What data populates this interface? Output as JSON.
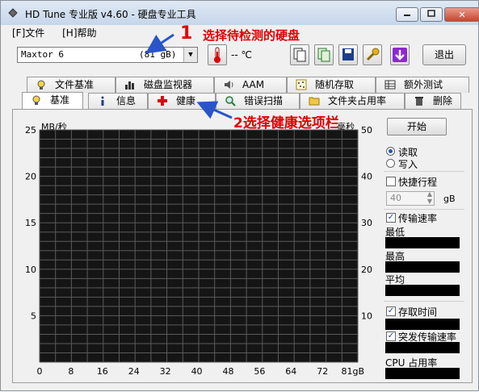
{
  "window": {
    "title": "HD Tune 专业版 v4.60 - 硬盘专业工具"
  },
  "menu": {
    "file": "[F]文件",
    "help": "[H]帮助"
  },
  "toolbar": {
    "drive": "Maxtor 6",
    "drive_capacity": "(81 gB)",
    "temperature": "-- ℃",
    "exit_label": "退出"
  },
  "tabs_top": [
    "文件基准",
    "磁盘监视器",
    "AAM",
    "随机存取",
    "额外测试"
  ],
  "tabs_bottom": [
    "基准",
    "信息",
    "健康",
    "错误扫描",
    "文件夹占用率",
    "删除"
  ],
  "chart": {
    "left_unit": "MB/秒",
    "right_unit": "毫秒",
    "left_ticks": [
      "25",
      "20",
      "15",
      "10",
      "5"
    ],
    "right_ticks": [
      "50",
      "40",
      "30",
      "20",
      "10"
    ],
    "x_ticks": [
      "0",
      "8",
      "16",
      "24",
      "32",
      "40",
      "48",
      "56",
      "64",
      "72",
      "81gB"
    ]
  },
  "chart_data": {
    "type": "line",
    "title": "",
    "xlabel": "",
    "ylabel": "MB/秒",
    "y2label": "毫秒",
    "xlim": [
      0,
      81
    ],
    "ylim": [
      0,
      25
    ],
    "y2lim": [
      0,
      50
    ],
    "x_tick_labels": [
      "0",
      "8",
      "16",
      "24",
      "32",
      "40",
      "48",
      "56",
      "64",
      "72",
      "81gB"
    ],
    "series": [],
    "grid": true
  },
  "side": {
    "start": "开始",
    "read": "读取",
    "write": "写入",
    "short_stroke": "快捷行程",
    "short_stroke_value": "40",
    "unit_gb": "gB",
    "transfer_rate": "传输速率",
    "min": "最低",
    "max": "最高",
    "avg": "平均",
    "access_time": "存取时间",
    "burst_rate": "突发传输速率",
    "cpu": "CPU 占用率"
  },
  "annotations": {
    "a1_num": "1",
    "a1_text": "选择待检测的硬盘",
    "a2_text": "2选择健康选项栏"
  },
  "colors": {
    "annotation": "#e00000",
    "arrow": "#2a55c8",
    "chart_bg": "#151515",
    "grid": "#5a5a5a"
  }
}
